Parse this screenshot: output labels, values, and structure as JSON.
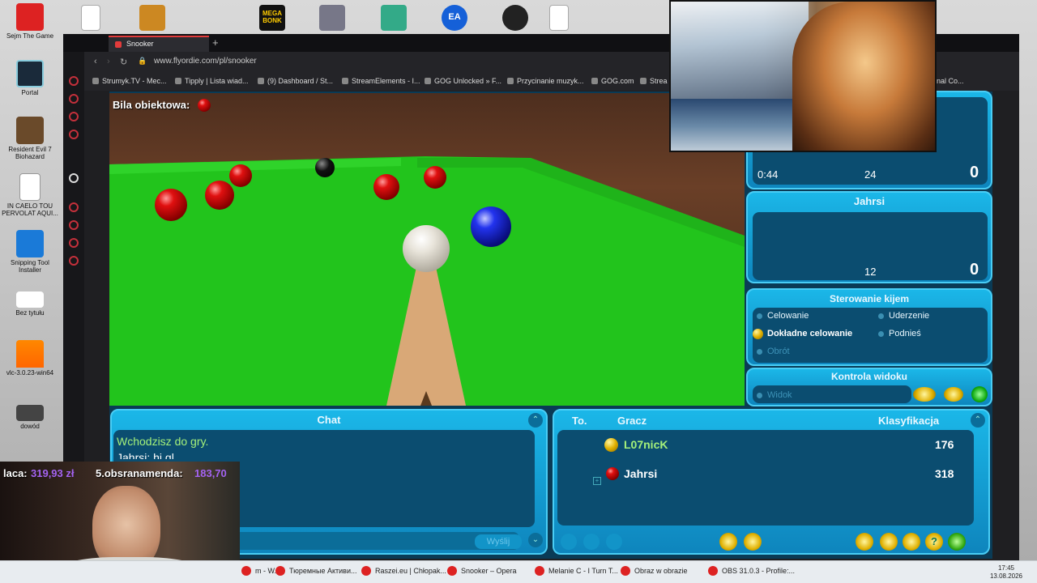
{
  "desktop": {
    "icons": [
      {
        "label": "Sejm The Game"
      },
      {
        "label": "Portal"
      },
      {
        "label": "Resident Evil 7 Biohazard"
      },
      {
        "label": "IN CAELO TOU PERVOLAT AQUI..."
      },
      {
        "label": "Snipping Tool Installer"
      },
      {
        "label": "Bez tytułu"
      },
      {
        "label": "vlc-3.0.23-win64"
      },
      {
        "label": "dowód"
      }
    ],
    "top_icons": [
      "MEGA BONK",
      "EA"
    ]
  },
  "browser": {
    "tab_title": "Snooker",
    "new_tab": "+",
    "url": "www.flyordie.com/pl/snooker",
    "bookmarks": [
      "Strumyk.TV - Mec...",
      "Tipply | Lista wiad...",
      "(9) Dashboard / St...",
      "StreamElements - I...",
      "GOG Unlocked » F...",
      "Przycinanie muzyk...",
      "GOG.com",
      "Strea",
      "nal Co..."
    ]
  },
  "game": {
    "object_ball_label": "Bila obiektowa:",
    "score_panel": {
      "time": "0:44",
      "points": "24",
      "score": "0"
    },
    "player2_panel": {
      "name": "Jahrsi",
      "points": "12",
      "score": "0"
    },
    "cue_control": {
      "title": "Sterowanie kijem",
      "options": {
        "aim": "Celowanie",
        "strike": "Uderzenie",
        "precise_aim": "Dokładne celowanie",
        "raise": "Podnieś",
        "spin": "Obrót"
      }
    },
    "view_control": {
      "title": "Kontrola widoku",
      "view": "Widok"
    },
    "chat": {
      "title": "Chat",
      "messages": [
        "Wchodzisz do gry.",
        "Jahrsi: hi gl"
      ],
      "send": "Wyślij"
    },
    "players_list": {
      "col_to": "To.",
      "col_player": "Gracz",
      "col_rank": "Klasyfikacja",
      "rows": [
        {
          "name": "L07nicK",
          "rating": "176",
          "ball": "yellow"
        },
        {
          "name": "Jahrsi",
          "rating": "318",
          "ball": "red"
        }
      ]
    }
  },
  "stream_overlay": {
    "donation_1_name": "laca:",
    "donation_1_amount": "319,93 zł",
    "donation_2_name": "5.obsranamenda:",
    "donation_2_amount": "183,70"
  },
  "taskbar": {
    "apps": [
      "m - W...",
      "Тюремные Активи...",
      "Raszei.eu | Chłopak...",
      "Snooker – Opera",
      "Melanie C - I Turn T...",
      "Obraz w obrazie",
      "OBS 31.0.3 - Profile:..."
    ],
    "time": "17:45",
    "date": "13.08.2026"
  },
  "colors": {
    "felt": "#22c41c",
    "panel": "#1bb7e8",
    "panel_dark": "#0b4d70",
    "chat_text": "#a4f07a",
    "accent": "#e23b3b"
  }
}
